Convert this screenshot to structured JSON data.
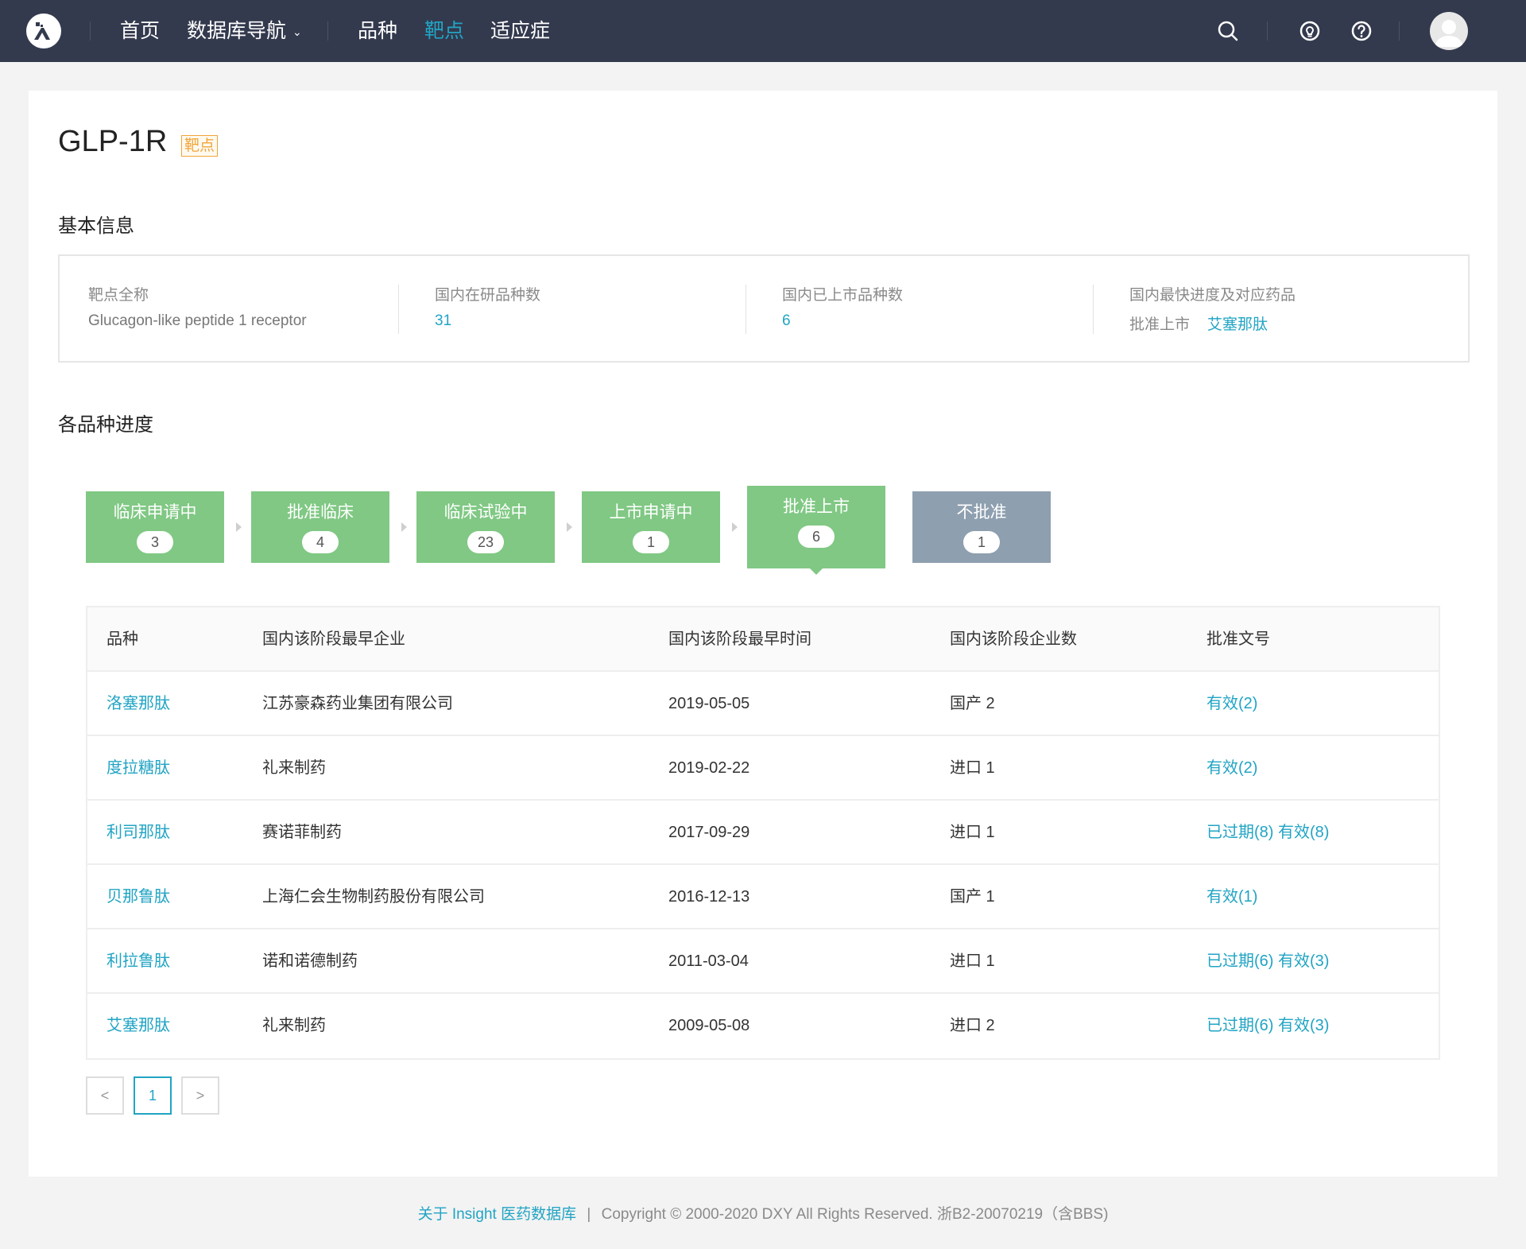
{
  "nav": {
    "items": [
      {
        "label": "首页",
        "active": false
      },
      {
        "label": "数据库导航",
        "active": false,
        "has_dropdown": true
      },
      {
        "label": "品种",
        "active": false
      },
      {
        "label": "靶点",
        "active": true
      },
      {
        "label": "适应症",
        "active": false
      }
    ],
    "icons": [
      "search-icon",
      "bulb-icon",
      "help-icon"
    ],
    "dropdown_glyph": "⌄"
  },
  "page": {
    "title": "GLP-1R",
    "tag": "靶点"
  },
  "basic_info": {
    "section_title": "基本信息",
    "full_name_label": "靶点全称",
    "full_name_value": "Glucagon-like peptide 1 receptor",
    "in_research_label": "国内在研品种数",
    "in_research_value": "31",
    "marketed_label": "国内已上市品种数",
    "marketed_value": "6",
    "fastest_label": "国内最快进度及对应药品",
    "fastest_stage": "批准上市",
    "fastest_drug": "艾塞那肽"
  },
  "progress": {
    "section_title": "各品种进度",
    "stages": [
      {
        "label": "临床申请中",
        "count": "3",
        "active": false
      },
      {
        "label": "批准临床",
        "count": "4",
        "active": false
      },
      {
        "label": "临床试验中",
        "count": "23",
        "active": false
      },
      {
        "label": "上市申请中",
        "count": "1",
        "active": false
      },
      {
        "label": "批准上市",
        "count": "6",
        "active": true
      },
      {
        "label": "不批准",
        "count": "1",
        "active": false
      }
    ]
  },
  "table": {
    "headers": [
      "品种",
      "国内该阶段最早企业",
      "国内该阶段最早时间",
      "国内该阶段企业数",
      "批准文号"
    ],
    "rows": [
      {
        "drug": "洛塞那肽",
        "company": "江苏豪森药业集团有限公司",
        "date": "2019-05-05",
        "count": "国产 2",
        "approval": "有效(2)"
      },
      {
        "drug": "度拉糖肽",
        "company": "礼来制药",
        "date": "2019-02-22",
        "count": "进口 1",
        "approval": "有效(2)"
      },
      {
        "drug": "利司那肽",
        "company": "赛诺菲制药",
        "date": "2017-09-29",
        "count": "进口 1",
        "approval": "已过期(8) 有效(8)"
      },
      {
        "drug": "贝那鲁肽",
        "company": "上海仁会生物制药股份有限公司",
        "date": "2016-12-13",
        "count": "国产 1",
        "approval": "有效(1)"
      },
      {
        "drug": "利拉鲁肽",
        "company": "诺和诺德制药",
        "date": "2011-03-04",
        "count": "进口 1",
        "approval": "已过期(6) 有效(3)"
      },
      {
        "drug": "艾塞那肽",
        "company": "礼来制药",
        "date": "2009-05-08",
        "count": "进口 2",
        "approval": "已过期(6) 有效(3)"
      }
    ]
  },
  "pagination": {
    "prev": "<",
    "current": "1",
    "next": ">"
  },
  "footer": {
    "about_link": "关于 Insight 医药数据库",
    "separator": "|",
    "copyright": "Copyright © 2000-2020 DXY All Rights Reserved. 浙B2-20070219（含BBS)"
  },
  "colors": {
    "nav_bg": "#343a4e",
    "accent": "#21a4c4",
    "stage_green": "#80c884",
    "stage_gray": "#8e9faf",
    "tag_orange": "#f0a53a"
  }
}
